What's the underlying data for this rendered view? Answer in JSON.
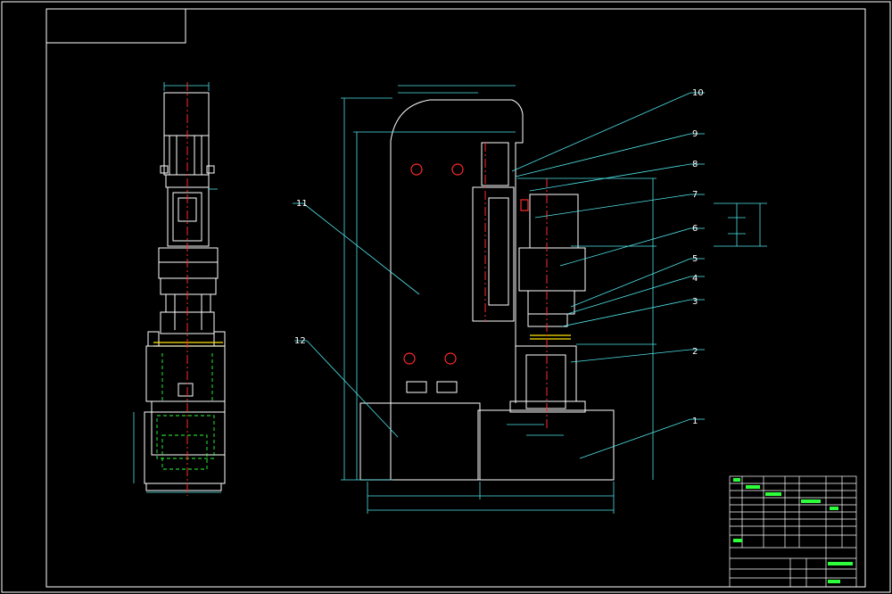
{
  "drawing": {
    "background": "#000000",
    "colors": {
      "outline": "#ffffff",
      "dimension": "#4fe3e8",
      "centerline": "#ff2a2a",
      "hidden": "#2dff3a",
      "highlight": "#ffe600"
    },
    "part_labels": [
      "1",
      "2",
      "3",
      "4",
      "5",
      "6",
      "7",
      "8",
      "9",
      "10",
      "11",
      "12"
    ]
  }
}
